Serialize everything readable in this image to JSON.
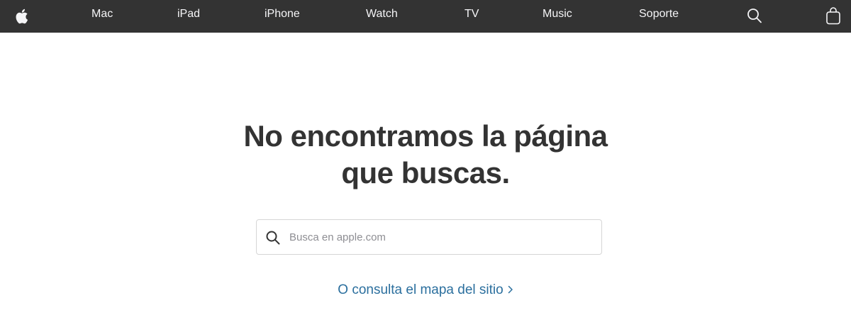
{
  "nav": {
    "logo_icon": "apple-logo-icon",
    "items": [
      {
        "label": "Mac"
      },
      {
        "label": "iPad"
      },
      {
        "label": "iPhone"
      },
      {
        "label": "Watch"
      },
      {
        "label": "TV"
      },
      {
        "label": "Music"
      },
      {
        "label": "Soporte"
      }
    ],
    "search_icon": "search-icon",
    "bag_icon": "shopping-bag-icon"
  },
  "main": {
    "headline_line1": "No encontramos la página",
    "headline_line2": "que buscas.",
    "search": {
      "icon": "search-icon",
      "placeholder": "Busca en apple.com",
      "value": ""
    },
    "sitemap_link": "O consulta el mapa del sitio",
    "sitemap_chevron": "chevron-right-icon"
  },
  "colors": {
    "nav_background": "#333333",
    "nav_text": "#f5f5f7",
    "headline": "#333333",
    "link": "#2b6f9e",
    "search_border": "#d6d6d6"
  }
}
